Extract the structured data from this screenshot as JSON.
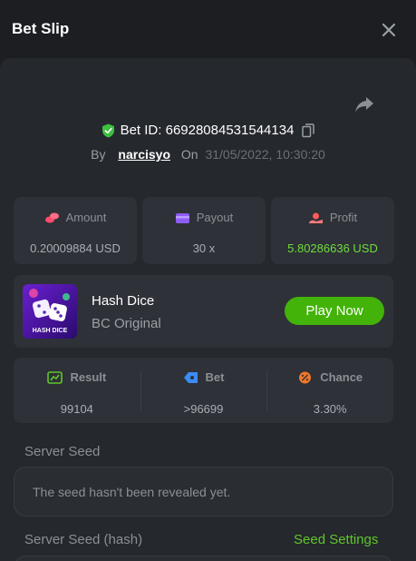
{
  "header": {
    "title": "Bet Slip"
  },
  "bet": {
    "id_text": "Bet ID: 66928084531544134",
    "by_label": "By",
    "user": "narcisyo",
    "on_label": "On",
    "datetime": "31/05/2022, 10:30:20"
  },
  "stats": [
    {
      "label": "Amount",
      "value": "0.20009884 USD",
      "icon": "coins-icon"
    },
    {
      "label": "Payout",
      "value": "30 x",
      "icon": "wallet-icon"
    },
    {
      "label": "Profit",
      "value": "5.80286636 USD",
      "icon": "profit-icon"
    }
  ],
  "game": {
    "name": "Hash Dice",
    "provider": "BC Original",
    "thumb_text": "HASH DICE",
    "play_label": "Play Now"
  },
  "details": [
    {
      "label": "Result",
      "value": "99104",
      "icon": "result-icon"
    },
    {
      "label": "Bet",
      "value": ">96699",
      "icon": "bet-tag-icon"
    },
    {
      "label": "Chance",
      "value": "3.30%",
      "icon": "percent-icon"
    }
  ],
  "seeds": {
    "server_seed_label": "Server Seed",
    "server_seed_text": "The seed hasn't been revealed yet.",
    "server_seed_hash_label": "Server Seed (hash)",
    "seed_settings_label": "Seed Settings"
  },
  "colors": {
    "accent_green": "#43b309",
    "profit_green": "#6fdc3e",
    "background": "#1c1e22",
    "panel": "#25282d",
    "card": "#2e3137"
  }
}
